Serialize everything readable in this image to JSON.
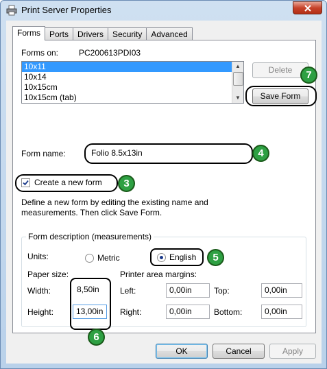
{
  "window": {
    "title": "Print Server Properties"
  },
  "tabs": [
    "Forms",
    "Ports",
    "Drivers",
    "Security",
    "Advanced"
  ],
  "forms_on": {
    "label": "Forms on:",
    "server": "PC200613PDI03"
  },
  "forms_list": [
    "10x11",
    "10x14",
    "10x15cm",
    "10x15cm (tab)"
  ],
  "buttons": {
    "delete": "Delete",
    "save_form": "Save Form",
    "ok": "OK",
    "cancel": "Cancel",
    "apply": "Apply"
  },
  "form_name": {
    "label": "Form name:",
    "value": "Folio 8.5x13in"
  },
  "create_new_form": {
    "label": "Create a new form",
    "checked": true
  },
  "help_text": "Define a new form by editing the existing name and measurements. Then click Save Form.",
  "description": {
    "title": "Form description (measurements)",
    "units_label": "Units:",
    "metric_label": "Metric",
    "english_label": "English",
    "selected_unit": "English",
    "paper_size_label": "Paper size:",
    "margins_label": "Printer area margins:",
    "width_label": "Width:",
    "width_value": "8,50in",
    "height_label": "Height:",
    "height_value": "13,00in",
    "left_label": "Left:",
    "left_value": "0,00in",
    "right_label": "Right:",
    "right_value": "0,00in",
    "top_label": "Top:",
    "top_value": "0,00in",
    "bottom_label": "Bottom:",
    "bottom_value": "0,00in"
  },
  "callouts": {
    "c3": "3",
    "c4": "4",
    "c5": "5",
    "c6": "6",
    "c7": "7"
  },
  "colors": {
    "callout_badge": "#2ea043",
    "list_selection": "#3399ff",
    "close_button": "#c7432b"
  }
}
